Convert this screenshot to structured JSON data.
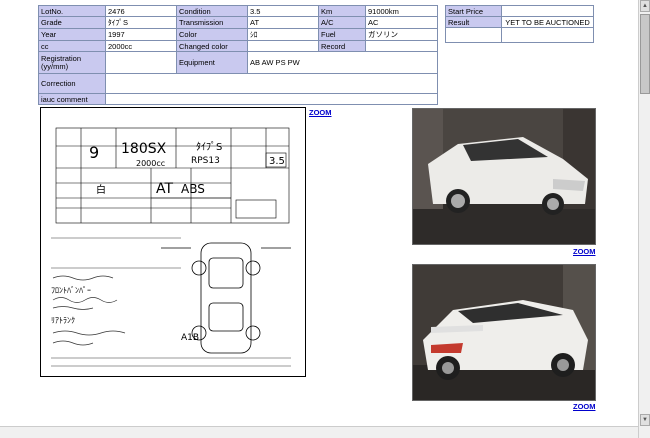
{
  "lot": {
    "rows": [
      [
        {
          "label": "LotNo.",
          "value": "2476"
        },
        {
          "label": "Condition",
          "value": "3.5"
        },
        {
          "label": "Km",
          "value": "91000km"
        }
      ],
      [
        {
          "label": "Grade",
          "value": "ﾀｲﾌﾟS"
        },
        {
          "label": "Transmission",
          "value": "AT"
        },
        {
          "label": "A/C",
          "value": "AC"
        }
      ],
      [
        {
          "label": "Year",
          "value": "1997"
        },
        {
          "label": "Color",
          "value": "ｼﾛ"
        },
        {
          "label": "Fuel",
          "value": "ガソリン"
        }
      ],
      [
        {
          "label": "cc",
          "value": "2000cc"
        },
        {
          "label": "Changed color",
          "value": ""
        },
        {
          "label": "Record",
          "value": ""
        }
      ]
    ],
    "registration_label": "Registration (yy/mm)",
    "registration_value": "",
    "equipment_label": "Equipment",
    "equipment_value": "AB AW PS PW",
    "correction_label": "Correction",
    "correction_value": "",
    "comment_label": "iauc comment",
    "comment_value": ""
  },
  "price": {
    "start_label": "Start Price",
    "start_value": "",
    "result_label": "Result",
    "result_value": "YET TO BE AUCTIONED"
  },
  "zoom_label": "ZOOM",
  "sheet": {
    "lot_no": "9",
    "model": "180SX",
    "grade": "ﾀｲﾌﾟS",
    "chassis": "RPS13",
    "cc": "2000cc",
    "score": "3.5",
    "transmission": "AT",
    "equipment": "ABS",
    "color": "白",
    "notes_1": "ﾌﾛﾝﾄﾊﾞﾝﾊﾟｰ",
    "notes_2": "A1B",
    "notes_3": "ﾘｱﾄﾗﾝｸ"
  },
  "colors": {
    "label_bg": "#c9c9ef",
    "border": "#7f8fb0",
    "link": "#0000cc"
  }
}
